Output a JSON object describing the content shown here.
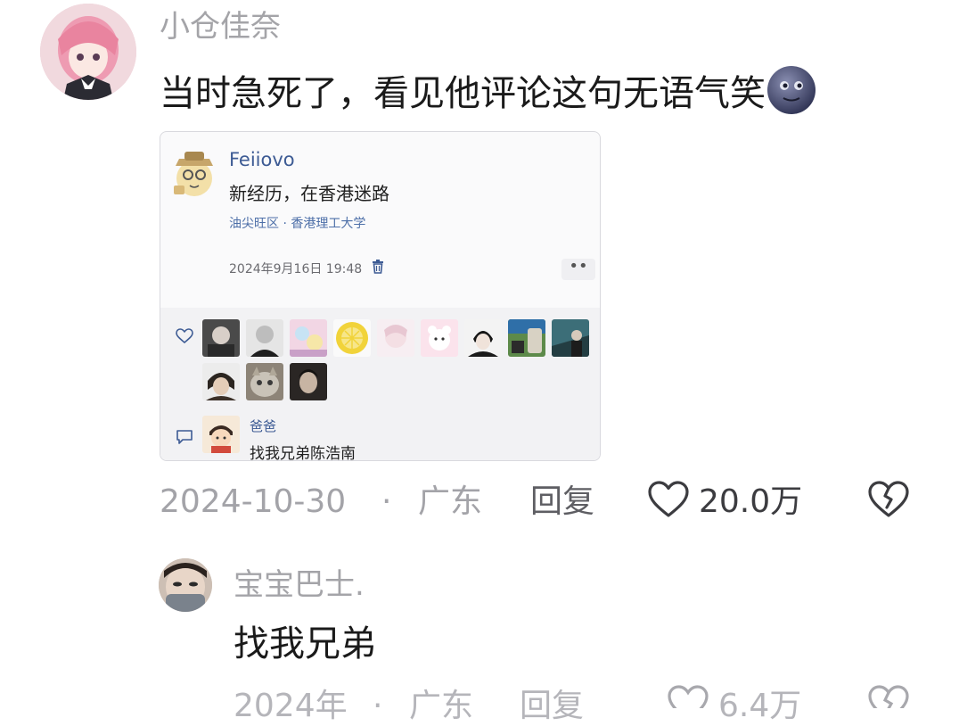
{
  "main_comment": {
    "username": "小仓佳奈",
    "text": "当时急死了，看见他评论这句无语气笑",
    "emoji": "new-moon-face-emoji",
    "date": "2024-10-30",
    "separator": "·",
    "location": "广东",
    "reply_label": "回复",
    "like_count": "20.0万",
    "like_icon": "heart-outline-icon",
    "dislike_icon": "broken-heart-icon"
  },
  "card": {
    "poster_name": "Feiiovo",
    "post_text": "新经历，在香港迷路",
    "location": "油尖旺区 · 香港理工大学",
    "timestamp": "2024年9月16日 19:48",
    "more_label": "••",
    "reply": {
      "name": "爸爸",
      "text": "找我兄弟陈浩南"
    }
  },
  "sub_comment": {
    "username": "宝宝巴士.",
    "text": "找我兄弟",
    "date": "2024年",
    "separator": "·",
    "location": "广东",
    "reply_label": "回复",
    "like_count": "6.4万"
  },
  "colors": {
    "link_blue": "#3d5b94",
    "meta_gray": "#a3a3a8"
  }
}
